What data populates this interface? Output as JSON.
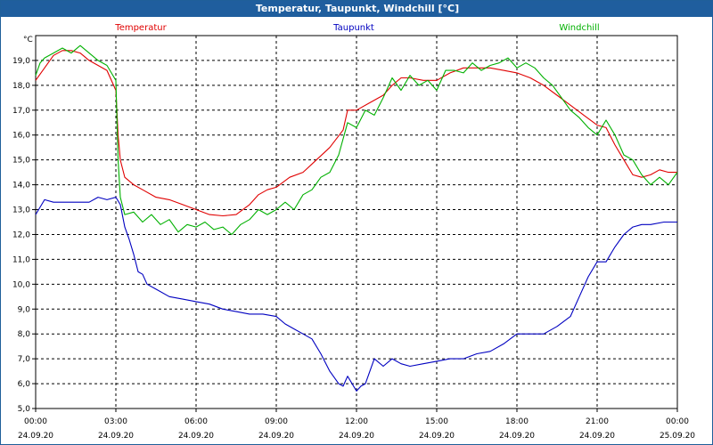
{
  "window": {
    "title": "Temperatur, Taupunkt, Windchill [°C]"
  },
  "colors": {
    "titlebar": "#1f5e9e",
    "temperature": "#e00000",
    "dewpoint": "#0000c0",
    "windchill": "#00b000",
    "grid": "#000000"
  },
  "chart_data": {
    "type": "line",
    "title": "Temperatur, Taupunkt, Windchill [°C]",
    "ylabel": "°C",
    "ylim": [
      5.0,
      20.0
    ],
    "xlim": [
      "2020-09-24T00:00",
      "2020-09-25T00:00"
    ],
    "grid": true,
    "legend_placement": "top",
    "y_ticks": [
      "5,0",
      "6,0",
      "7,0",
      "8,0",
      "9,0",
      "10,0",
      "11,0",
      "12,0",
      "13,0",
      "14,0",
      "15,0",
      "16,0",
      "17,0",
      "18,0",
      "19,0"
    ],
    "x_ticks": [
      {
        "time": "00:00",
        "date": "24.09.20"
      },
      {
        "time": "03:00",
        "date": "24.09.20"
      },
      {
        "time": "06:00",
        "date": "24.09.20"
      },
      {
        "time": "09:00",
        "date": "24.09.20"
      },
      {
        "time": "12:00",
        "date": "24.09.20"
      },
      {
        "time": "15:00",
        "date": "24.09.20"
      },
      {
        "time": "18:00",
        "date": "24.09.20"
      },
      {
        "time": "21:00",
        "date": "24.09.20"
      },
      {
        "time": "00:00",
        "date": "25.09.20"
      }
    ],
    "series": [
      {
        "name": "Temperatur",
        "points": [
          [
            "24.09.20 00:00",
            18.2
          ],
          [
            "24.09.20 00:20",
            18.7
          ],
          [
            "24.09.20 00:40",
            19.2
          ],
          [
            "24.09.20 01:00",
            19.4
          ],
          [
            "24.09.20 01:20",
            19.4
          ],
          [
            "24.09.20 01:40",
            19.3
          ],
          [
            "24.09.20 02:00",
            19.0
          ],
          [
            "24.09.20 02:20",
            18.8
          ],
          [
            "24.09.20 02:40",
            18.6
          ],
          [
            "24.09.20 03:00",
            17.8
          ],
          [
            "24.09.20 03:05",
            16.0
          ],
          [
            "24.09.20 03:10",
            15.0
          ],
          [
            "24.09.20 03:20",
            14.3
          ],
          [
            "24.09.20 03:40",
            14.0
          ],
          [
            "24.09.20 04:00",
            13.8
          ],
          [
            "24.09.20 04:30",
            13.5
          ],
          [
            "24.09.20 05:00",
            13.4
          ],
          [
            "24.09.20 05:30",
            13.2
          ],
          [
            "24.09.20 06:00",
            13.0
          ],
          [
            "24.09.20 06:30",
            12.8
          ],
          [
            "24.09.20 07:00",
            12.75
          ],
          [
            "24.09.20 07:30",
            12.8
          ],
          [
            "24.09.20 08:00",
            13.2
          ],
          [
            "24.09.20 08:20",
            13.6
          ],
          [
            "24.09.20 08:40",
            13.8
          ],
          [
            "24.09.20 09:00",
            13.9
          ],
          [
            "24.09.20 09:30",
            14.3
          ],
          [
            "24.09.20 10:00",
            14.5
          ],
          [
            "24.09.20 10:30",
            15.0
          ],
          [
            "24.09.20 11:00",
            15.5
          ],
          [
            "24.09.20 11:30",
            16.2
          ],
          [
            "24.09.20 11:40",
            17.0
          ],
          [
            "24.09.20 12:00",
            17.0
          ],
          [
            "24.09.20 12:30",
            17.3
          ],
          [
            "24.09.20 13:00",
            17.6
          ],
          [
            "24.09.20 13:20",
            18.0
          ],
          [
            "24.09.20 13:40",
            18.3
          ],
          [
            "24.09.20 14:00",
            18.3
          ],
          [
            "24.09.20 14:30",
            18.2
          ],
          [
            "24.09.20 15:00",
            18.2
          ],
          [
            "24.09.20 15:30",
            18.5
          ],
          [
            "24.09.20 16:00",
            18.7
          ],
          [
            "24.09.20 16:30",
            18.7
          ],
          [
            "24.09.20 17:00",
            18.7
          ],
          [
            "24.09.20 17:30",
            18.6
          ],
          [
            "24.09.20 18:00",
            18.5
          ],
          [
            "24.09.20 18:30",
            18.3
          ],
          [
            "24.09.20 19:00",
            18.0
          ],
          [
            "24.09.20 19:30",
            17.6
          ],
          [
            "24.09.20 20:00",
            17.2
          ],
          [
            "24.09.20 20:30",
            16.8
          ],
          [
            "24.09.20 21:00",
            16.4
          ],
          [
            "24.09.20 21:20",
            16.3
          ],
          [
            "24.09.20 21:40",
            15.6
          ],
          [
            "24.09.20 22:00",
            15.0
          ],
          [
            "24.09.20 22:20",
            14.4
          ],
          [
            "24.09.20 22:40",
            14.3
          ],
          [
            "24.09.20 23:00",
            14.4
          ],
          [
            "24.09.20 23:20",
            14.6
          ],
          [
            "24.09.20 23:40",
            14.5
          ],
          [
            "25.09.20 00:00",
            14.5
          ]
        ]
      },
      {
        "name": "Taupunkt",
        "points": [
          [
            "24.09.20 00:00",
            12.8
          ],
          [
            "24.09.20 00:20",
            13.4
          ],
          [
            "24.09.20 00:40",
            13.3
          ],
          [
            "24.09.20 01:00",
            13.3
          ],
          [
            "24.09.20 01:30",
            13.3
          ],
          [
            "24.09.20 02:00",
            13.3
          ],
          [
            "24.09.20 02:20",
            13.5
          ],
          [
            "24.09.20 02:40",
            13.4
          ],
          [
            "24.09.20 03:00",
            13.5
          ],
          [
            "24.09.20 03:10",
            13.2
          ],
          [
            "24.09.20 03:20",
            12.3
          ],
          [
            "24.09.20 03:30",
            11.8
          ],
          [
            "24.09.20 03:40",
            11.2
          ],
          [
            "24.09.20 03:50",
            10.5
          ],
          [
            "24.09.20 04:00",
            10.4
          ],
          [
            "24.09.20 04:10",
            10.0
          ],
          [
            "24.09.20 04:30",
            9.8
          ],
          [
            "24.09.20 05:00",
            9.5
          ],
          [
            "24.09.20 05:30",
            9.4
          ],
          [
            "24.09.20 06:00",
            9.3
          ],
          [
            "24.09.20 06:30",
            9.2
          ],
          [
            "24.09.20 07:00",
            9.0
          ],
          [
            "24.09.20 07:30",
            8.9
          ],
          [
            "24.09.20 08:00",
            8.8
          ],
          [
            "24.09.20 08:30",
            8.8
          ],
          [
            "24.09.20 09:00",
            8.7
          ],
          [
            "24.09.20 09:20",
            8.4
          ],
          [
            "24.09.20 09:40",
            8.2
          ],
          [
            "24.09.20 10:00",
            8.0
          ],
          [
            "24.09.20 10:20",
            7.8
          ],
          [
            "24.09.20 10:40",
            7.2
          ],
          [
            "24.09.20 11:00",
            6.5
          ],
          [
            "24.09.20 11:20",
            6.0
          ],
          [
            "24.09.20 11:30",
            5.9
          ],
          [
            "24.09.20 11:40",
            6.3
          ],
          [
            "24.09.20 12:00",
            5.7
          ],
          [
            "24.09.20 12:10",
            5.9
          ],
          [
            "24.09.20 12:20",
            6.0
          ],
          [
            "24.09.20 12:40",
            7.0
          ],
          [
            "24.09.20 13:00",
            6.7
          ],
          [
            "24.09.20 13:20",
            7.0
          ],
          [
            "24.09.20 13:40",
            6.8
          ],
          [
            "24.09.20 14:00",
            6.7
          ],
          [
            "24.09.20 14:30",
            6.8
          ],
          [
            "24.09.20 15:00",
            6.9
          ],
          [
            "24.09.20 15:30",
            7.0
          ],
          [
            "24.09.20 16:00",
            7.0
          ],
          [
            "24.09.20 16:30",
            7.2
          ],
          [
            "24.09.20 17:00",
            7.3
          ],
          [
            "24.09.20 17:30",
            7.6
          ],
          [
            "24.09.20 18:00",
            8.0
          ],
          [
            "24.09.20 18:30",
            8.0
          ],
          [
            "24.09.20 19:00",
            8.0
          ],
          [
            "24.09.20 19:30",
            8.3
          ],
          [
            "24.09.20 20:00",
            8.7
          ],
          [
            "24.09.20 20:20",
            9.5
          ],
          [
            "24.09.20 20:40",
            10.3
          ],
          [
            "24.09.20 21:00",
            10.9
          ],
          [
            "24.09.20 21:20",
            10.9
          ],
          [
            "24.09.20 21:40",
            11.5
          ],
          [
            "24.09.20 22:00",
            12.0
          ],
          [
            "24.09.20 22:20",
            12.3
          ],
          [
            "24.09.20 22:40",
            12.4
          ],
          [
            "24.09.20 23:00",
            12.4
          ],
          [
            "24.09.20 23:30",
            12.5
          ],
          [
            "25.09.20 00:00",
            12.5
          ]
        ]
      },
      {
        "name": "Windchill",
        "points": [
          [
            "24.09.20 00:00",
            18.4
          ],
          [
            "24.09.20 00:10",
            18.9
          ],
          [
            "24.09.20 00:20",
            19.1
          ],
          [
            "24.09.20 00:40",
            19.3
          ],
          [
            "24.09.20 01:00",
            19.5
          ],
          [
            "24.09.20 01:20",
            19.3
          ],
          [
            "24.09.20 01:40",
            19.6
          ],
          [
            "24.09.20 02:00",
            19.3
          ],
          [
            "24.09.20 02:20",
            19.0
          ],
          [
            "24.09.20 02:40",
            18.8
          ],
          [
            "24.09.20 03:00",
            18.2
          ],
          [
            "24.09.20 03:05",
            15.0
          ],
          [
            "24.09.20 03:10",
            13.5
          ],
          [
            "24.09.20 03:20",
            12.8
          ],
          [
            "24.09.20 03:40",
            12.9
          ],
          [
            "24.09.20 04:00",
            12.5
          ],
          [
            "24.09.20 04:20",
            12.8
          ],
          [
            "24.09.20 04:40",
            12.4
          ],
          [
            "24.09.20 05:00",
            12.6
          ],
          [
            "24.09.20 05:20",
            12.1
          ],
          [
            "24.09.20 05:40",
            12.4
          ],
          [
            "24.09.20 06:00",
            12.3
          ],
          [
            "24.09.20 06:20",
            12.5
          ],
          [
            "24.09.20 06:40",
            12.2
          ],
          [
            "24.09.20 07:00",
            12.3
          ],
          [
            "24.09.20 07:20",
            12.0
          ],
          [
            "24.09.20 07:40",
            12.4
          ],
          [
            "24.09.20 08:00",
            12.6
          ],
          [
            "24.09.20 08:20",
            13.0
          ],
          [
            "24.09.20 08:40",
            12.8
          ],
          [
            "24.09.20 09:00",
            13.0
          ],
          [
            "24.09.20 09:20",
            13.3
          ],
          [
            "24.09.20 09:40",
            13.0
          ],
          [
            "24.09.20 10:00",
            13.6
          ],
          [
            "24.09.20 10:20",
            13.8
          ],
          [
            "24.09.20 10:40",
            14.3
          ],
          [
            "24.09.20 11:00",
            14.5
          ],
          [
            "24.09.20 11:20",
            15.2
          ],
          [
            "24.09.20 11:40",
            16.5
          ],
          [
            "24.09.20 12:00",
            16.3
          ],
          [
            "24.09.20 12:20",
            17.0
          ],
          [
            "24.09.20 12:40",
            16.8
          ],
          [
            "24.09.20 13:00",
            17.5
          ],
          [
            "24.09.20 13:20",
            18.3
          ],
          [
            "24.09.20 13:40",
            17.8
          ],
          [
            "24.09.20 14:00",
            18.4
          ],
          [
            "24.09.20 14:20",
            18.0
          ],
          [
            "24.09.20 14:40",
            18.2
          ],
          [
            "24.09.20 15:00",
            17.8
          ],
          [
            "24.09.20 15:20",
            18.6
          ],
          [
            "24.09.20 15:40",
            18.6
          ],
          [
            "24.09.20 16:00",
            18.5
          ],
          [
            "24.09.20 16:20",
            18.9
          ],
          [
            "24.09.20 16:40",
            18.6
          ],
          [
            "24.09.20 17:00",
            18.8
          ],
          [
            "24.09.20 17:20",
            18.9
          ],
          [
            "24.09.20 17:40",
            19.1
          ],
          [
            "24.09.20 18:00",
            18.7
          ],
          [
            "24.09.20 18:20",
            18.9
          ],
          [
            "24.09.20 18:40",
            18.7
          ],
          [
            "24.09.20 19:00",
            18.3
          ],
          [
            "24.09.20 19:20",
            18.0
          ],
          [
            "24.09.20 19:40",
            17.5
          ],
          [
            "24.09.20 20:00",
            17.0
          ],
          [
            "24.09.20 20:20",
            16.7
          ],
          [
            "24.09.20 20:40",
            16.3
          ],
          [
            "24.09.20 21:00",
            16.0
          ],
          [
            "24.09.20 21:20",
            16.6
          ],
          [
            "24.09.20 21:40",
            16.0
          ],
          [
            "24.09.20 22:00",
            15.2
          ],
          [
            "24.09.20 22:20",
            15.0
          ],
          [
            "24.09.20 22:40",
            14.4
          ],
          [
            "24.09.20 23:00",
            14.0
          ],
          [
            "24.09.20 23:20",
            14.3
          ],
          [
            "24.09.20 23:40",
            14.0
          ],
          [
            "25.09.20 00:00",
            14.5
          ]
        ]
      }
    ]
  }
}
